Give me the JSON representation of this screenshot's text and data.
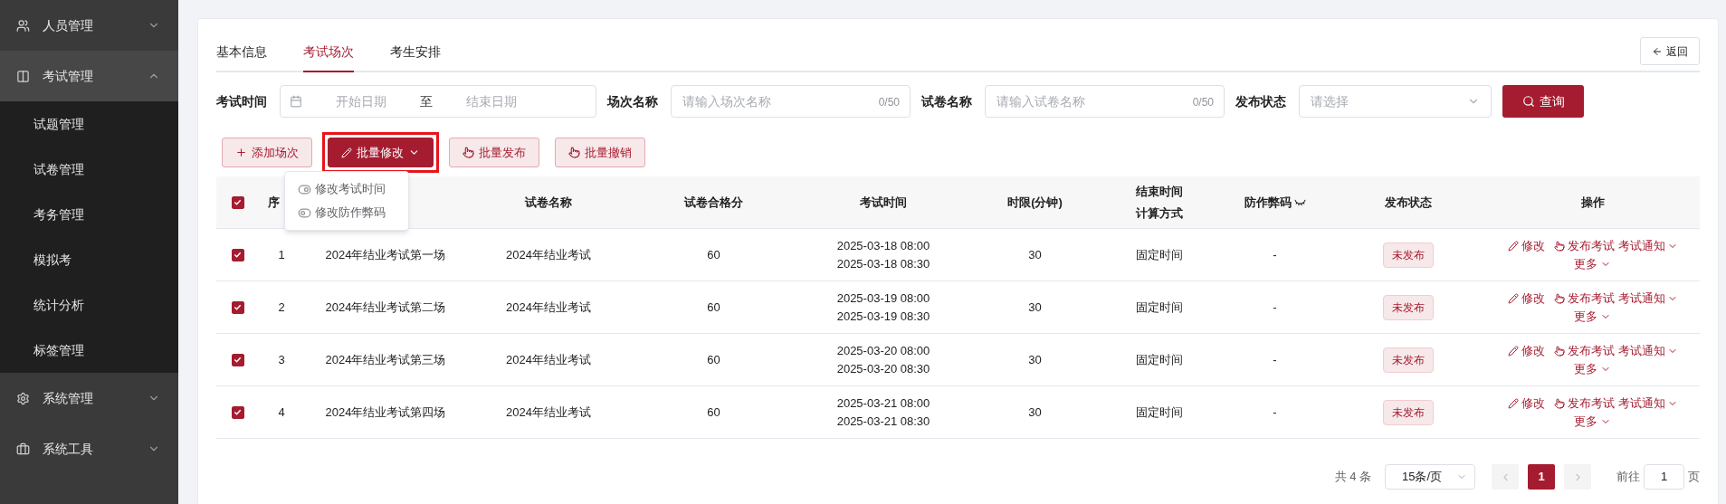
{
  "sidebar": {
    "items": [
      {
        "label": "人员管理",
        "expanded": false
      },
      {
        "label": "考试管理",
        "expanded": true,
        "children": [
          {
            "label": "试题管理"
          },
          {
            "label": "试卷管理"
          },
          {
            "label": "考务管理"
          },
          {
            "label": "模拟考"
          },
          {
            "label": "统计分析"
          },
          {
            "label": "标签管理"
          }
        ]
      },
      {
        "label": "系统管理",
        "expanded": false
      },
      {
        "label": "系统工具",
        "expanded": false
      }
    ]
  },
  "tabs": [
    {
      "label": "基本信息",
      "selected": false
    },
    {
      "label": "考试场次",
      "selected": true
    },
    {
      "label": "考生安排",
      "selected": false
    }
  ],
  "back_button": "返回",
  "filters": [
    {
      "kind": "date_range",
      "label": "考试时间",
      "start_placeholder": "开始日期",
      "separator": "至",
      "end_placeholder": "结束日期"
    },
    {
      "kind": "text",
      "label": "场次名称",
      "placeholder": "请输入场次名称",
      "counter": "0/50"
    },
    {
      "kind": "text",
      "label": "试卷名称",
      "placeholder": "请输入试卷名称",
      "counter": "0/50"
    },
    {
      "kind": "select",
      "label": "发布状态",
      "placeholder": "请选择"
    }
  ],
  "search_button": "查询",
  "actions": [
    {
      "kind": "add",
      "label": "添加场次",
      "highlighted": false
    },
    {
      "kind": "menu",
      "label": "批量修改",
      "highlighted": true
    },
    {
      "kind": "hand",
      "label": "批量发布",
      "highlighted": false
    },
    {
      "kind": "hand",
      "label": "批量撤销",
      "highlighted": false
    }
  ],
  "dropdown_menu": {
    "items": [
      {
        "label": "修改考试时间"
      },
      {
        "label": "修改防作弊码"
      }
    ]
  },
  "table": {
    "all_checked": true,
    "columns": [
      "序",
      "试卷名称",
      "试卷合格分",
      "考试时间",
      "时限(分钟)",
      [
        "结束时间",
        "计算方式"
      ],
      "防作弊码",
      "发布状态",
      "操作"
    ],
    "rows": [
      {
        "selected": true,
        "index": "1",
        "session_name": "2024年结业考试第一场",
        "paper_name": "2024年结业考试",
        "pass_score": "60",
        "start": "2025-03-18 08:00",
        "end": "2025-03-18 08:30",
        "duration": "30",
        "end_mode": "固定时间",
        "anti_cheat_code": "-",
        "status": "未发布",
        "actions": [
          "修改",
          "发布考试",
          "考试通知",
          "更多"
        ]
      },
      {
        "selected": true,
        "index": "2",
        "session_name": "2024年结业考试第二场",
        "paper_name": "2024年结业考试",
        "pass_score": "60",
        "start": "2025-03-19 08:00",
        "end": "2025-03-19 08:30",
        "duration": "30",
        "end_mode": "固定时间",
        "anti_cheat_code": "-",
        "status": "未发布",
        "actions": [
          "修改",
          "发布考试",
          "考试通知",
          "更多"
        ]
      },
      {
        "selected": true,
        "index": "3",
        "session_name": "2024年结业考试第三场",
        "paper_name": "2024年结业考试",
        "pass_score": "60",
        "start": "2025-03-20 08:00",
        "end": "2025-03-20 08:30",
        "duration": "30",
        "end_mode": "固定时间",
        "anti_cheat_code": "-",
        "status": "未发布",
        "actions": [
          "修改",
          "发布考试",
          "考试通知",
          "更多"
        ]
      },
      {
        "selected": true,
        "index": "4",
        "session_name": "2024年结业考试第四场",
        "paper_name": "2024年结业考试",
        "pass_score": "60",
        "start": "2025-03-21 08:00",
        "end": "2025-03-21 08:30",
        "duration": "30",
        "end_mode": "固定时间",
        "anti_cheat_code": "-",
        "status": "未发布",
        "actions": [
          "修改",
          "发布考试",
          "考试通知",
          "更多"
        ]
      }
    ]
  },
  "pagination": {
    "total": "共 4 条",
    "page_size": "15条/页",
    "prev_disabled": true,
    "next_disabled": true,
    "pages": [
      {
        "label": "1",
        "selected": true
      }
    ],
    "goto_label": "前往",
    "goto_value": "1",
    "goto_suffix": "页"
  }
}
